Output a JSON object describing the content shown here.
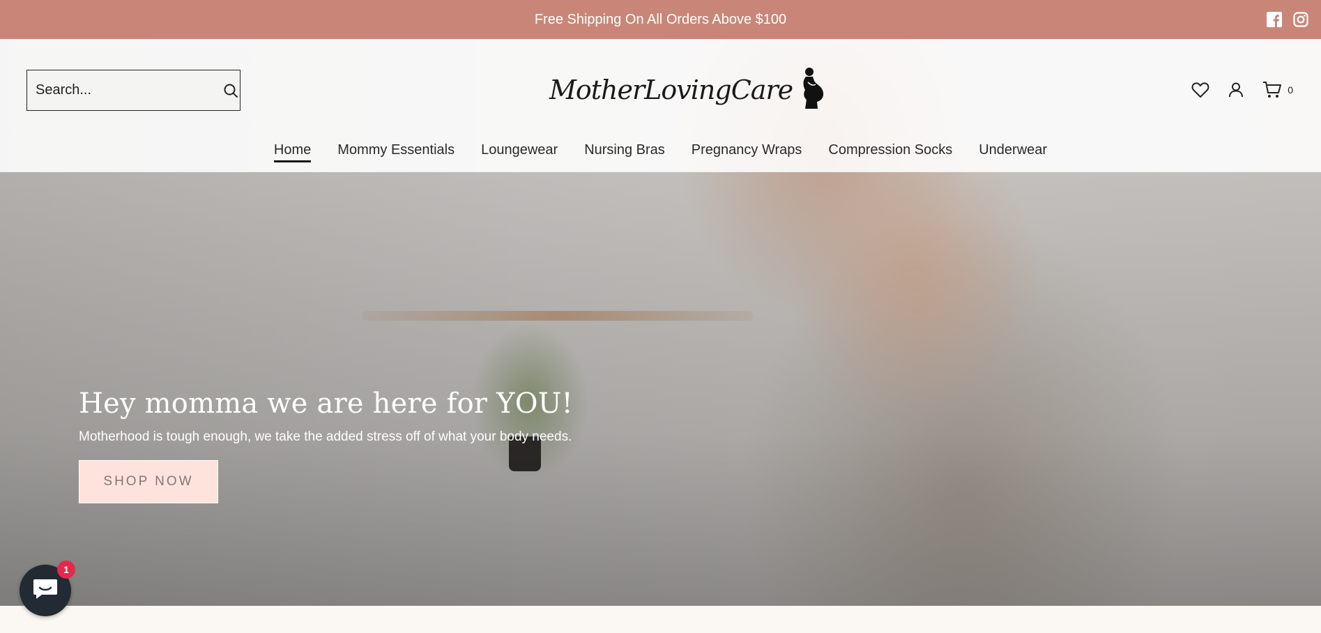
{
  "announcement": {
    "text": "Free Shipping On All Orders Above $100"
  },
  "social": {
    "icons": [
      "facebook-icon",
      "instagram-icon"
    ]
  },
  "header": {
    "search_placeholder": "Search...",
    "logo_text": "MotherLovingCare",
    "cart_count": "0"
  },
  "nav": {
    "items": [
      {
        "label": "Home",
        "active": true
      },
      {
        "label": "Mommy Essentials"
      },
      {
        "label": "Loungewear"
      },
      {
        "label": "Nursing Bras"
      },
      {
        "label": "Pregnancy Wraps"
      },
      {
        "label": "Compression Socks"
      },
      {
        "label": "Underwear"
      }
    ]
  },
  "hero": {
    "title": "Hey momma we are here for YOU!",
    "subtitle": "Motherhood is tough enough, we take the added stress off of what your body needs.",
    "cta": "SHOP NOW"
  },
  "chat": {
    "badge": "1"
  },
  "colors": {
    "announcement_bg": "#c98678",
    "cta_bg": "#fde3dc",
    "badge": "#e5294c",
    "chat_bg": "#222a33"
  }
}
